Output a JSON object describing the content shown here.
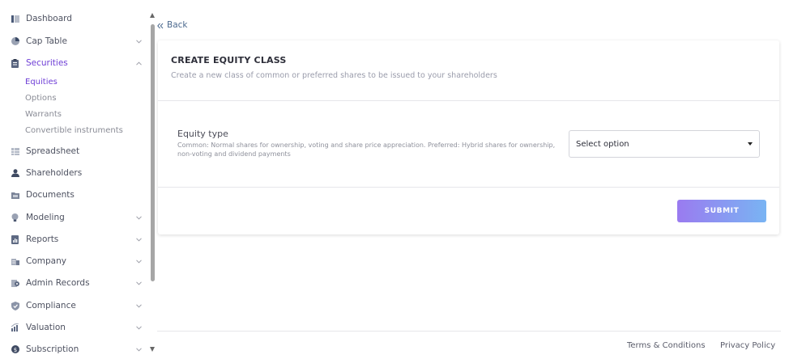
{
  "sidebar": {
    "items": [
      {
        "label": "Dashboard",
        "icon": "dashboard-icon",
        "expandable": false
      },
      {
        "label": "Cap Table",
        "icon": "pie-chart-icon",
        "expandable": true
      },
      {
        "label": "Securities",
        "icon": "clipboard-icon",
        "expandable": true,
        "active": true,
        "expanded": true
      },
      {
        "label": "Spreadsheet",
        "icon": "spreadsheet-icon",
        "expandable": false
      },
      {
        "label": "Shareholders",
        "icon": "person-icon",
        "expandable": false
      },
      {
        "label": "Documents",
        "icon": "folder-icon",
        "expandable": false
      },
      {
        "label": "Modeling",
        "icon": "lightbulb-icon",
        "expandable": true
      },
      {
        "label": "Reports",
        "icon": "report-icon",
        "expandable": true
      },
      {
        "label": "Company",
        "icon": "building-icon",
        "expandable": true
      },
      {
        "label": "Admin Records",
        "icon": "admin-records-icon",
        "expandable": true
      },
      {
        "label": "Compliance",
        "icon": "shield-check-icon",
        "expandable": true
      },
      {
        "label": "Valuation",
        "icon": "valuation-chart-icon",
        "expandable": true
      },
      {
        "label": "Subscription",
        "icon": "dollar-coin-icon",
        "expandable": true
      }
    ],
    "securities_subitems": [
      {
        "label": "Equities",
        "active": true
      },
      {
        "label": "Options"
      },
      {
        "label": "Warrants"
      },
      {
        "label": "Convertible instruments"
      }
    ]
  },
  "back": {
    "label": "Back"
  },
  "form": {
    "title": "CREATE EQUITY CLASS",
    "subtitle": "Create a new class of common or preferred shares to be issued to your shareholders",
    "equity_type": {
      "label": "Equity type",
      "help": "Common: Normal shares for ownership, voting and share price appreciation. Preferred: Hybrid shares for ownership, non-voting and dividend payments",
      "selected": "Select option"
    },
    "submit_label": "SUBMIT"
  },
  "footer": {
    "terms": "Terms & Conditions",
    "privacy": "Privacy Policy"
  },
  "colors": {
    "accent": "#6f3fd6",
    "submit_gradient_start": "#9a7bf0",
    "submit_gradient_end": "#79b4f3",
    "back_link": "#4d6a8f"
  }
}
